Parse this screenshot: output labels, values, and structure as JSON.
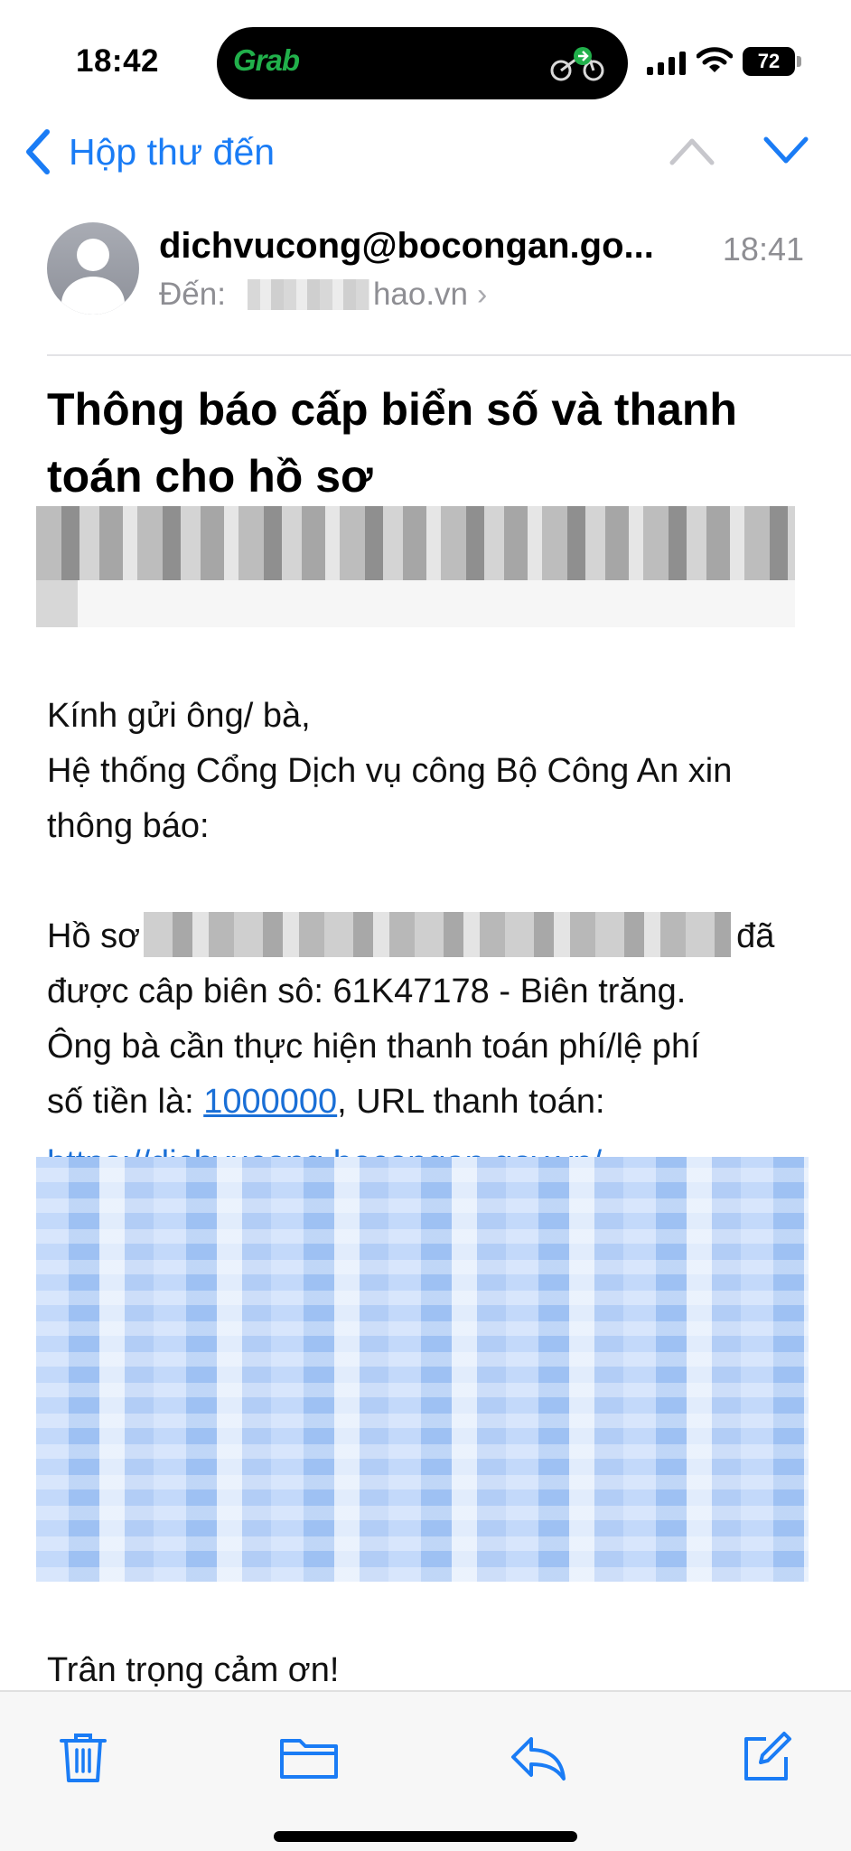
{
  "status_bar": {
    "time": "18:42",
    "island_app": "Grab",
    "battery": "72",
    "icons": [
      "signal-icon",
      "wifi-icon",
      "battery-icon",
      "motorbike-icon"
    ]
  },
  "nav": {
    "back_label": "Hộp thư đến",
    "icons": [
      "chevron-left-icon",
      "chevron-up-icon",
      "chevron-down-icon"
    ]
  },
  "email": {
    "sender": "dichvucong@bocongan.go...",
    "time": "18:41",
    "to_label": "Đến:",
    "to_value": "hao.vn",
    "subject": "Thông báo cấp biển số và thanh toán cho hồ sơ",
    "greeting": "Kính gửi ông/ bà,",
    "intro": "Hệ thống Cổng Dịch vụ công Bộ Công An xin thông báo:",
    "record_prefix": "Hồ sơ",
    "record_suffix": "đã",
    "record_line": "được câp biên sô: 61K47178 - Biên trăng.",
    "payment_line": "Ông bà cần thực hiện thanh toán phí/lệ phí",
    "amount_label": "số tiền là:",
    "amount": "1000000",
    "url_label": ", URL thanh toán:",
    "url_partial": "https://dichvucong.bocongan.gov.vn/",
    "signoff": "Trân trọng cảm ơn!"
  },
  "toolbar": {
    "icons": [
      "trash-icon",
      "folder-icon",
      "reply-icon",
      "compose-icon"
    ]
  },
  "colors": {
    "accent": "#1a7cf5",
    "link": "#1a6fd6",
    "secondary_text": "#8e8e93",
    "grab_green": "#21b04b"
  }
}
